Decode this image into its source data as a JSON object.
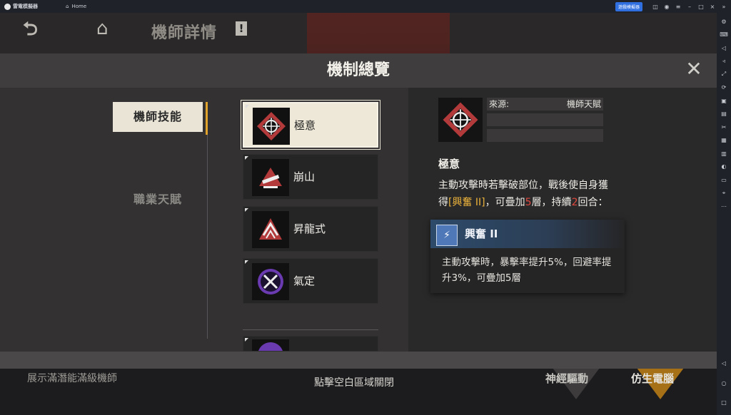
{
  "titlebar": {
    "app_name": "雷電模擬器",
    "tabs": [
      {
        "label": "Home"
      },
      {
        "label": "鋼嵐"
      }
    ],
    "badge": "遊戲模擬器"
  },
  "topbar": {
    "page_title": "機師詳情",
    "title_mark": "!"
  },
  "modal": {
    "title": "機制總覽",
    "categories": [
      {
        "label": "機師技能",
        "active": true
      },
      {
        "label": "職業天賦",
        "active": false
      }
    ],
    "skills": [
      {
        "name": "極意",
        "icon": "target-crosshair-icon",
        "active": true
      },
      {
        "name": "崩山",
        "icon": "mountain-strike-icon",
        "active": false
      },
      {
        "name": "昇龍式",
        "icon": "rising-dragon-icon",
        "active": false
      },
      {
        "name": "氣定",
        "icon": "crossed-swords-icon",
        "active": false
      },
      {
        "name": "",
        "icon": "purple-skill-icon",
        "active": false
      }
    ],
    "detail": {
      "source_label": "來源:",
      "source_value": "機師天賦",
      "name": "極意",
      "desc_part1": "主動攻擊時若擊破部位，戰後使自身獲得",
      "desc_buff": "[興奮 II]",
      "desc_part2": "，可疊加",
      "desc_num1": "5",
      "desc_part3": "層，持續",
      "desc_num2": "2",
      "desc_part4": "回合："
    },
    "tooltip": {
      "name": "興奮 II",
      "desc": "主動攻擊時，暴擊率提升5%，回避率提升3%，可疊加5層"
    }
  },
  "bottombar": {
    "left_text": "展示滿潛能滿級機師",
    "center_text": "點擊空白區域關閉",
    "btn1": "神經驅動",
    "btn2": "仿生電腦"
  },
  "colors": {
    "accent": "#e0a22a",
    "gold": "#e9b13a",
    "red": "#e0483e",
    "tooltip_blue": "#2d4a6a"
  }
}
